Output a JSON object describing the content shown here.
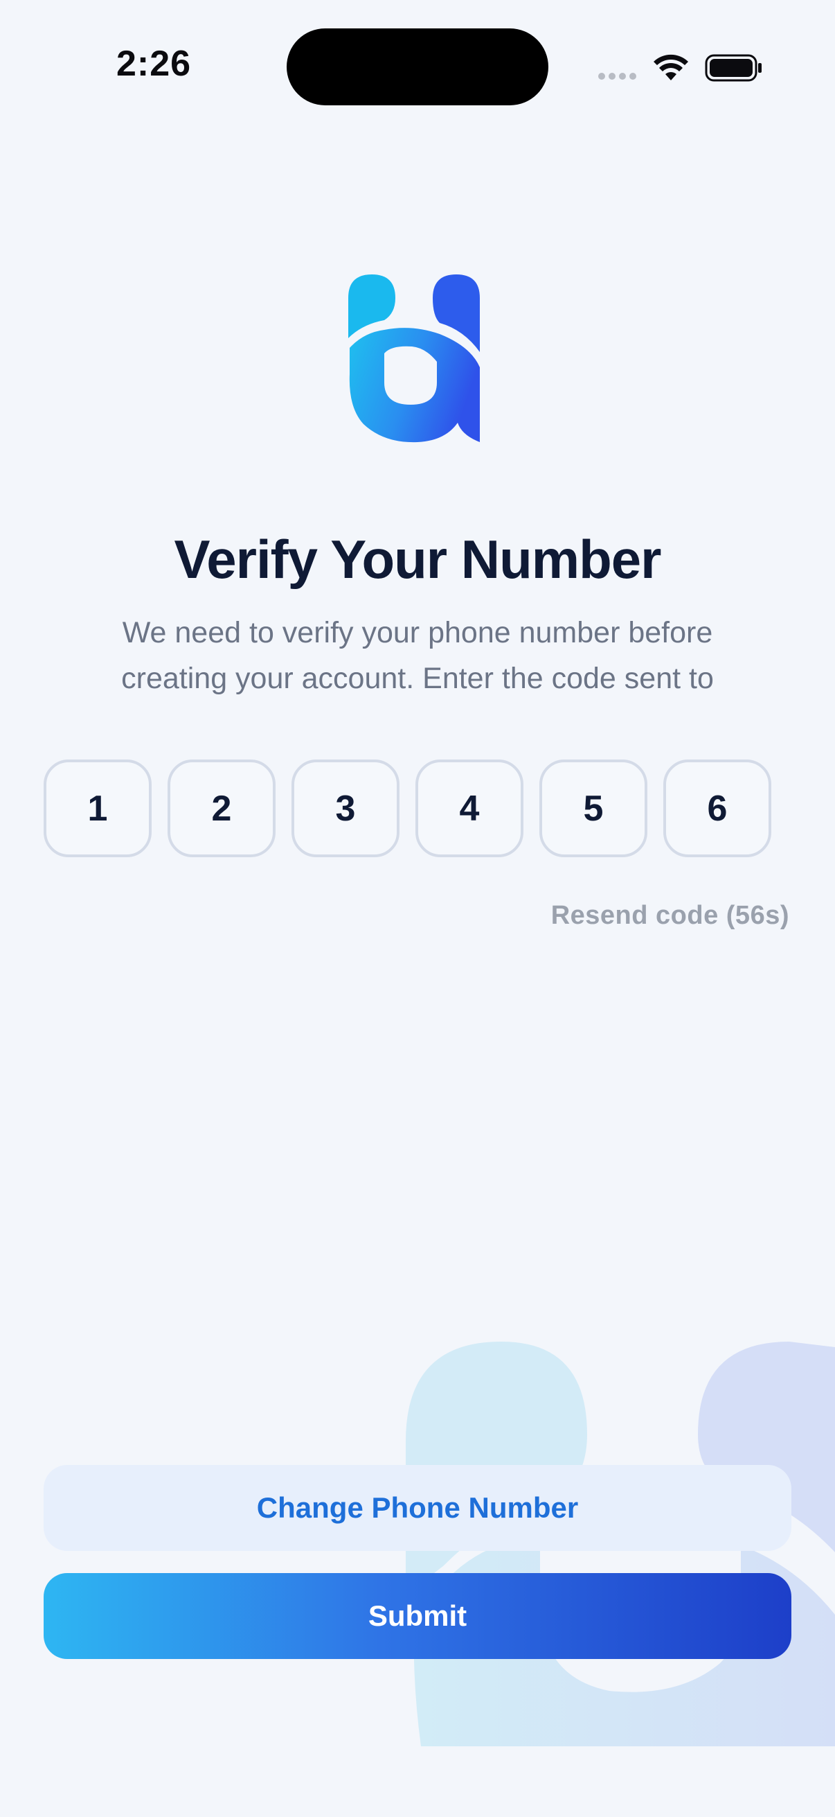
{
  "status_bar": {
    "time": "2:26"
  },
  "logo": {
    "icon": "app-logo-u"
  },
  "header": {
    "title": "Verify Your Number",
    "subtitle_line1": "We need to verify your phone number before",
    "subtitle_line2": "creating your account. Enter the code sent to"
  },
  "otp": {
    "digits": [
      "1",
      "2",
      "3",
      "4",
      "5",
      "6"
    ]
  },
  "resend": {
    "label": "Resend code (56s)"
  },
  "actions": {
    "change_phone_label": "Change Phone Number",
    "submit_label": "Submit"
  },
  "colors": {
    "background": "#f3f6fb",
    "title": "#0f1a35",
    "subtitle": "#6b7486",
    "accent": "#1e6fd9",
    "gradient_start": "#2eb6f2",
    "gradient_end": "#1d3fc9"
  }
}
